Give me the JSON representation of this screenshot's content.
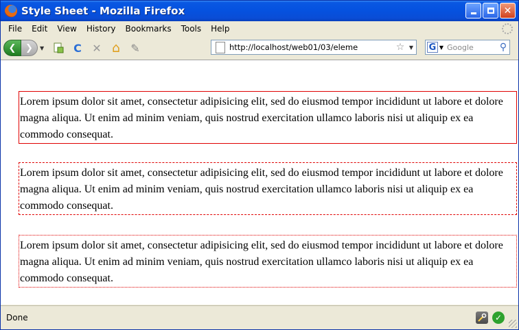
{
  "window": {
    "title": "Style Sheet - Mozilla Firefox",
    "minimize": "",
    "maximize": "",
    "close": "✕"
  },
  "menu": [
    "File",
    "Edit",
    "View",
    "History",
    "Bookmarks",
    "Tools",
    "Help"
  ],
  "toolbar": {
    "back": "❮",
    "forward": "❯",
    "reload": "C",
    "stop": "✕",
    "home": "⌂",
    "addons": "✎",
    "url": "http://localhost/web01/03/eleme",
    "bookmark_star": "☆",
    "dropdown": "▼",
    "search_engine": "G",
    "search_placeholder": "Google",
    "search_go": "⚲"
  },
  "content": {
    "paragraph": "Lorem ipsum dolor sit amet, consectetur adipisicing elit, sed do eiusmod tempor incididunt ut labore et dolore magna aliqua. Ut enim ad minim veniam, quis nostrud exercitation ullamco laboris nisi ut aliquip ex ea commodo consequat.",
    "border_color": "#e00000",
    "boxes": [
      {
        "border_style": "solid",
        "text": "Lorem ipsum dolor sit amet, consectetur adipisicing elit, sed do eiusmod tempor incididunt ut labore et dolore magna aliqua. Ut enim ad minim veniam, quis nostrud exercitation ullamco laboris nisi ut aliquip ex ea commodo consequat."
      },
      {
        "border_style": "dashed",
        "text": "Lorem ipsum dolor sit amet, consectetur adipisicing elit, sed do eiusmod tempor incididunt ut labore et dolore magna aliqua. Ut enim ad minim veniam, quis nostrud exercitation ullamco laboris nisi ut aliquip ex ea commodo consequat."
      },
      {
        "border_style": "dotted",
        "text": "Lorem ipsum dolor sit amet, consectetur adipisicing elit, sed do eiusmod tempor incididunt ut labore et dolore magna aliqua. Ut enim ad minim veniam, quis nostrud exercitation ullamco laboris nisi ut aliquip ex ea commodo consequat."
      }
    ]
  },
  "status": {
    "text": "Done",
    "devtool_icon": "devtools-icon",
    "check_icon": "✓"
  }
}
